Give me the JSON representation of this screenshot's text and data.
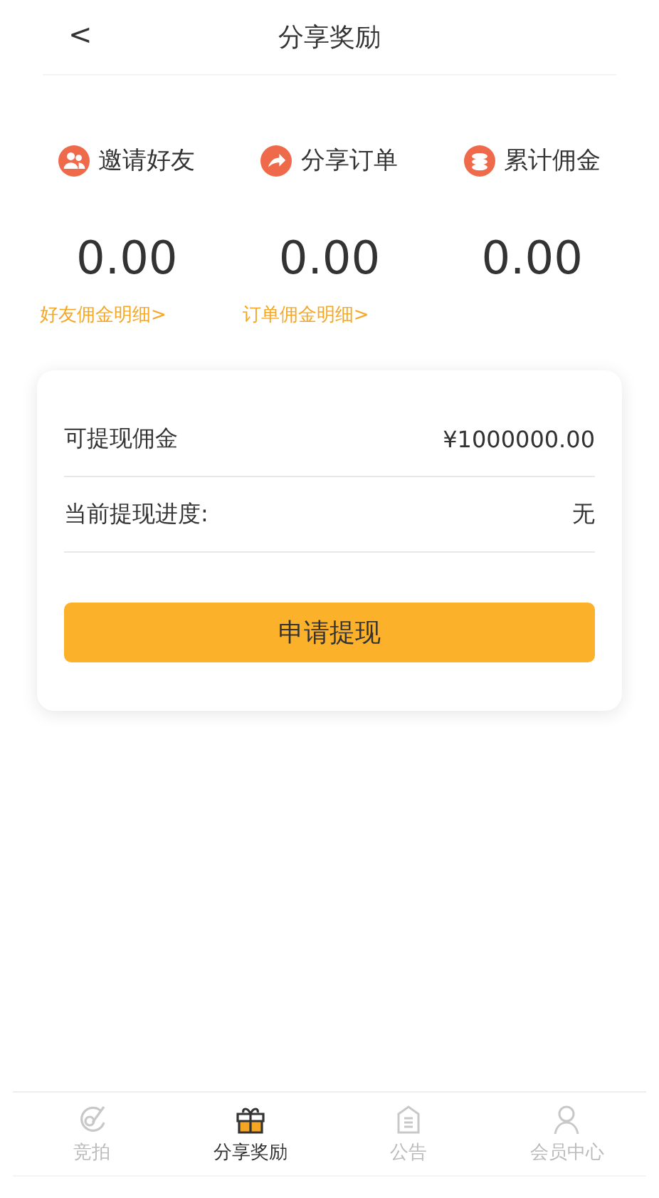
{
  "header": {
    "back": "<",
    "title": "分享奖励"
  },
  "stats": [
    {
      "label": "邀请好友",
      "value": "0.00",
      "link": "好友佣金明细>"
    },
    {
      "label": "分享订单",
      "value": "0.00",
      "link": "订单佣金明细>"
    },
    {
      "label": "累计佣金",
      "value": "0.00"
    }
  ],
  "card": {
    "rows": [
      {
        "label": "可提现佣金",
        "value": "¥1000000.00"
      },
      {
        "label": "当前提现进度:",
        "value": "无"
      }
    ],
    "button": "申请提现"
  },
  "tabbar": [
    {
      "label": "竞拍",
      "selected": false
    },
    {
      "label": "分享奖励",
      "selected": true
    },
    {
      "label": "公告",
      "selected": false
    },
    {
      "label": "会员中心",
      "selected": false
    }
  ]
}
